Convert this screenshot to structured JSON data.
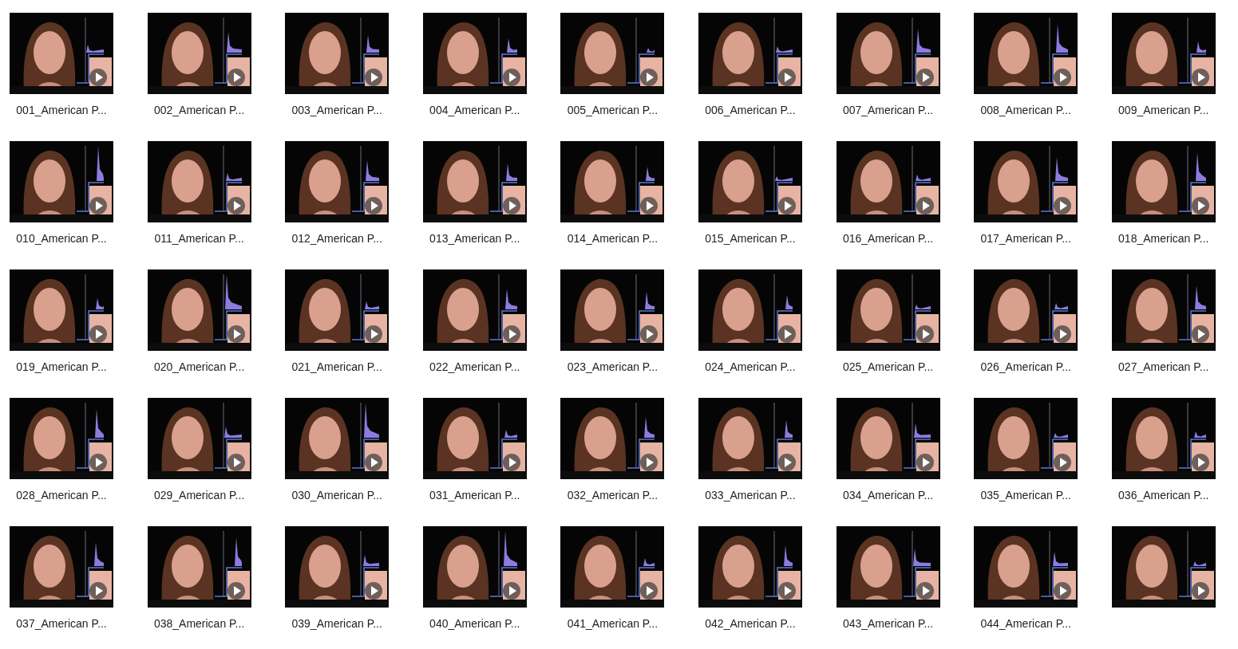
{
  "files": [
    {
      "label": "001_American P..."
    },
    {
      "label": "002_American P..."
    },
    {
      "label": "003_American P..."
    },
    {
      "label": "004_American P..."
    },
    {
      "label": "005_American P..."
    },
    {
      "label": "006_American P..."
    },
    {
      "label": "007_American P..."
    },
    {
      "label": "008_American P..."
    },
    {
      "label": "009_American P..."
    },
    {
      "label": "010_American P..."
    },
    {
      "label": "011_American P..."
    },
    {
      "label": "012_American P..."
    },
    {
      "label": "013_American P..."
    },
    {
      "label": "014_American P..."
    },
    {
      "label": "015_American P..."
    },
    {
      "label": "016_American P..."
    },
    {
      "label": "017_American P..."
    },
    {
      "label": "018_American P..."
    },
    {
      "label": "019_American P..."
    },
    {
      "label": "020_American P..."
    },
    {
      "label": "021_American P..."
    },
    {
      "label": "022_American P..."
    },
    {
      "label": "023_American P..."
    },
    {
      "label": "024_American P..."
    },
    {
      "label": "025_American P..."
    },
    {
      "label": "026_American P..."
    },
    {
      "label": "027_American P..."
    },
    {
      "label": "028_American P..."
    },
    {
      "label": "029_American P..."
    },
    {
      "label": "030_American P..."
    },
    {
      "label": "031_American P..."
    },
    {
      "label": "032_American P..."
    },
    {
      "label": "033_American P..."
    },
    {
      "label": "034_American P..."
    },
    {
      "label": "035_American P..."
    },
    {
      "label": "036_American P..."
    },
    {
      "label": "037_American P..."
    },
    {
      "label": "038_American P..."
    },
    {
      "label": "039_American P..."
    },
    {
      "label": "040_American P..."
    },
    {
      "label": "041_American P..."
    },
    {
      "label": "042_American P..."
    },
    {
      "label": "043_American P..."
    },
    {
      "label": "044_American P..."
    },
    {
      "kind": "video"
    }
  ]
}
